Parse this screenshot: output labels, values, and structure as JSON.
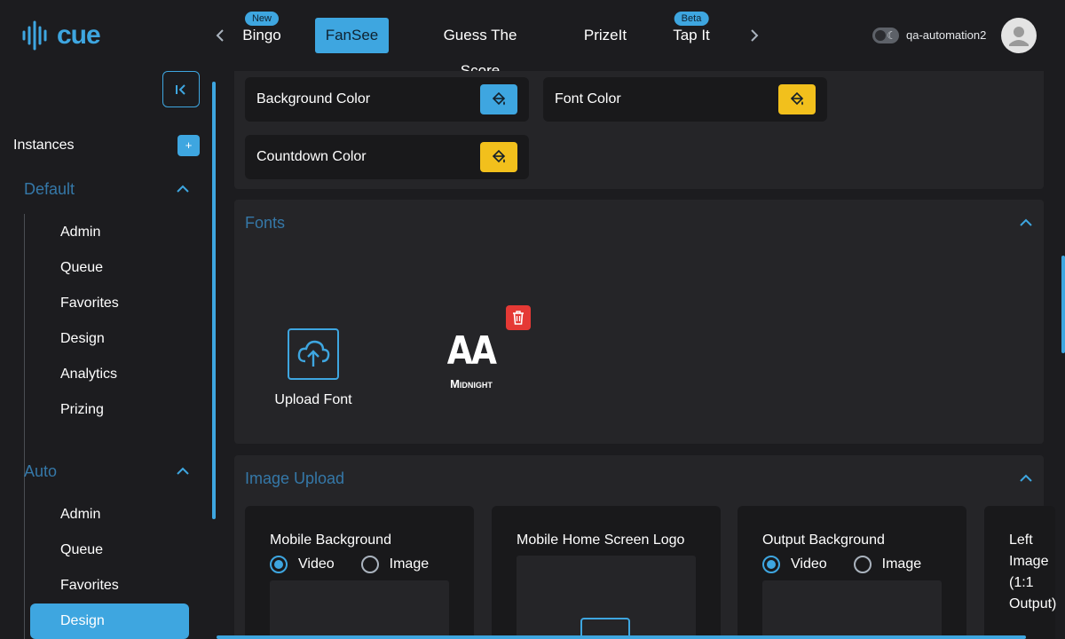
{
  "app": {
    "logo_text": "cue"
  },
  "nav": {
    "tabs": [
      {
        "label": "Bingo",
        "badge": "New"
      },
      {
        "label": "FanSee",
        "badge": ""
      },
      {
        "label": "Guess The Score",
        "badge": ""
      },
      {
        "label": "PrizeIt",
        "badge": ""
      },
      {
        "label": "Tap It",
        "badge": "Beta"
      }
    ],
    "prev_icon": "chevron-left-icon",
    "next_icon": "chevron-right-icon"
  },
  "user": {
    "name": "qa-automation2"
  },
  "sidebar": {
    "instances_label": "Instances",
    "add_label": "+",
    "groups": [
      {
        "title": "Default",
        "items": [
          "Admin",
          "Queue",
          "Favorites",
          "Design",
          "Analytics",
          "Prizing"
        ]
      },
      {
        "title": "Auto",
        "items": [
          "Admin",
          "Queue",
          "Favorites",
          "Design"
        ],
        "active": "Design"
      }
    ]
  },
  "colors": {
    "background_color_label": "Background Color",
    "font_color_label": "Font Color",
    "countdown_color_label": "Countdown Color",
    "background_color_value": "#3ea6e0",
    "font_color_value": "#f2c01c",
    "countdown_color_value": "#f2c01c"
  },
  "fonts": {
    "title": "Fonts",
    "upload_label": "Upload Font",
    "items": [
      {
        "sample": "AA",
        "name": "Midnight"
      }
    ]
  },
  "image_upload": {
    "title": "Image Upload",
    "panels": [
      {
        "title": "Mobile Background",
        "options": [
          "Video",
          "Image"
        ],
        "selected": "Video"
      },
      {
        "title": "Mobile Home Screen Logo"
      },
      {
        "title": "Output Background",
        "options": [
          "Video",
          "Image"
        ],
        "selected": "Video"
      },
      {
        "title": "Left Image (1:1 Output)"
      }
    ]
  },
  "theme": {
    "accent": "#3ea6e0",
    "muted_title": "#3578a8",
    "danger": "#e53935"
  }
}
